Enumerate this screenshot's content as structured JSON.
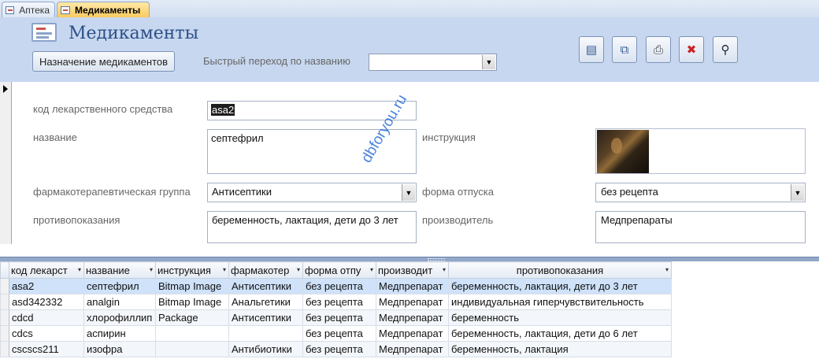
{
  "tabs": [
    {
      "label": "Аптека"
    },
    {
      "label": "Медикаменты"
    }
  ],
  "header": {
    "title": "Медикаменты",
    "assign_button": "Назначение медикаментов",
    "quick_nav_label": "Быстрый переход по названию",
    "quick_nav_value": "",
    "toolbar_icons": [
      "new-record-icon",
      "copy-record-icon",
      "print-icon",
      "delete-record-icon",
      "find-icon"
    ]
  },
  "form": {
    "code_label": "код лекарственного средства",
    "code_value": "asa2",
    "name_label": "название",
    "name_value": "септефрил",
    "instruction_label": "инструкция",
    "group_label": "фармакотерапевтическая группа",
    "group_value": "Антисептики",
    "release_label": "форма отпуска",
    "release_value": "без рецепта",
    "contra_label": "противопоказания",
    "contra_value": "беременность, лактация, дети до 3 лет",
    "maker_label": "производитель",
    "maker_value": "Медпрепараты"
  },
  "watermark": "dbforyou.ru",
  "table": {
    "columns": [
      "код лекарст",
      "название",
      "инструкция",
      "фармакотер",
      "форма отпу",
      "производит",
      "противопоказания"
    ],
    "rows": [
      [
        "asa2",
        "септефрил",
        "Bitmap Image",
        "Антисептики",
        "без рецепта",
        "Медпрепарат",
        "беременность, лактация, дети до 3 лет"
      ],
      [
        "asd342332",
        "analgin",
        "Bitmap Image",
        "Анальгетики",
        "без рецепта",
        "Медпрепарат",
        "индивидуальная гиперчувствительность"
      ],
      [
        "cdcd",
        "хлорофиллип",
        "Package",
        "Антисептики",
        "без рецепта",
        "Медпрепарат",
        "беременность"
      ],
      [
        "cdcs",
        "аспирин",
        "",
        "",
        "без рецепта",
        "Медпрепарат",
        "беременность, лактация, дети до 6 лет"
      ],
      [
        "cscscs211",
        "изофра",
        "",
        "Антибиотики",
        "без рецепта",
        "Медпрепарат",
        "беременность, лактация"
      ]
    ]
  }
}
